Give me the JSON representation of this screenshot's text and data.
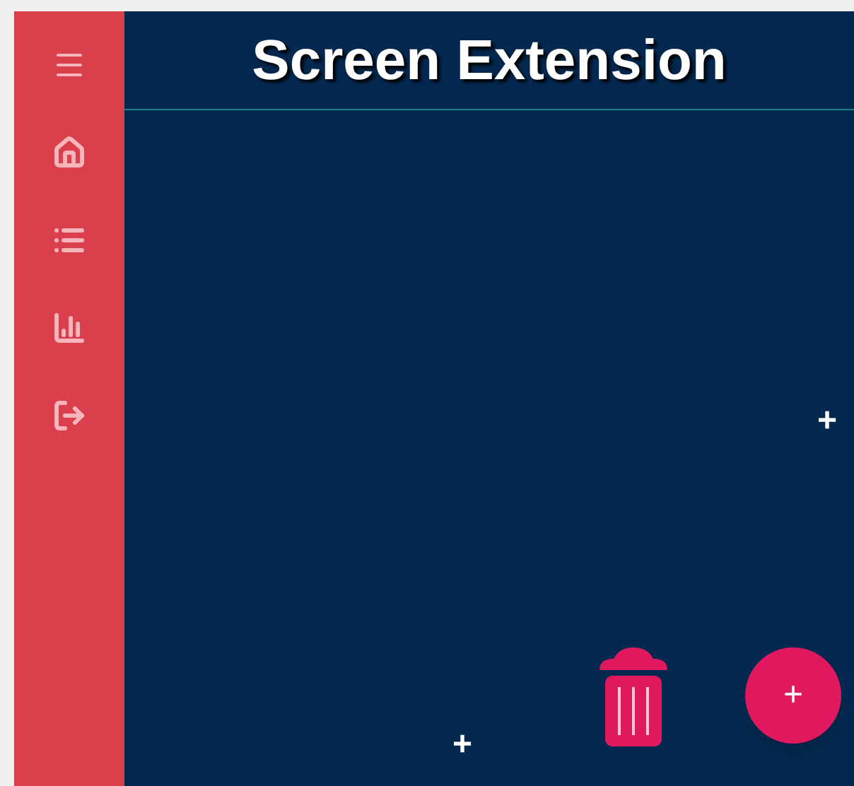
{
  "header": {
    "title": "Screen Extension"
  },
  "canvas": {
    "markers": [
      "+",
      "+"
    ],
    "fab": {
      "label": "+"
    }
  }
}
